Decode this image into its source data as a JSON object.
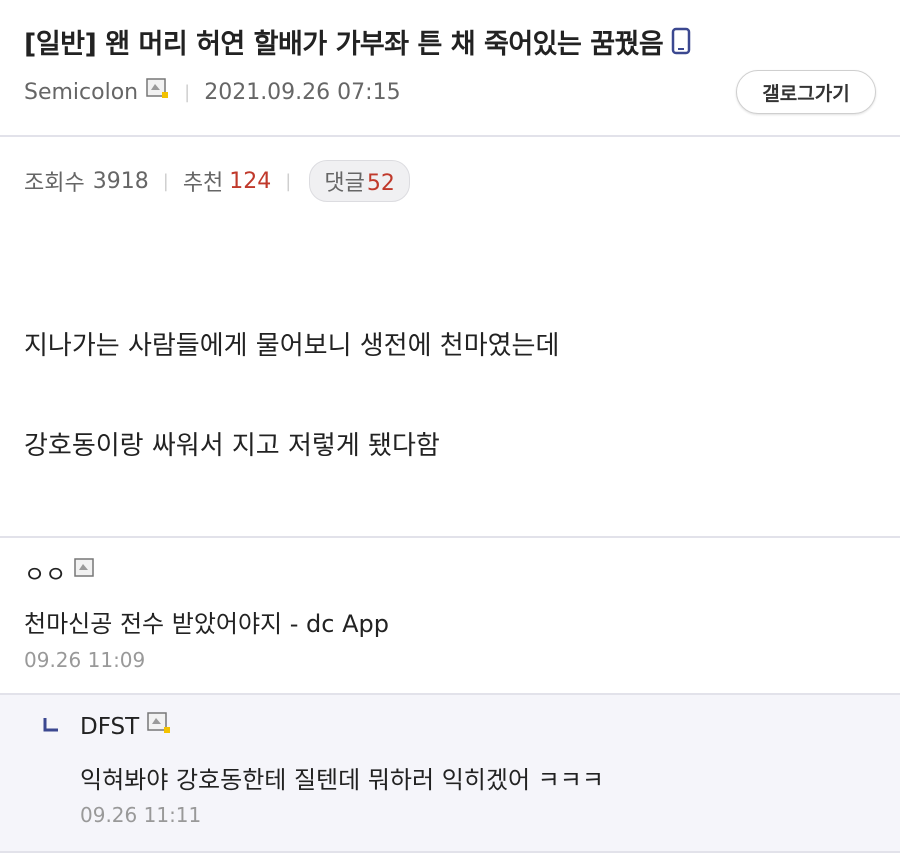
{
  "post": {
    "title": "[일반] 왠 머리 허연 할배가 가부좌 튼 채 죽어있는 꿈꿨음",
    "author": "Semicolon",
    "date": "2021.09.26 07:15",
    "gallery_button": "갤로그가기",
    "views_label": "조회수",
    "views": "3918",
    "recommend_label": "추천",
    "recommend": "124",
    "comments_label": "댓글",
    "comments": "52",
    "body_line1": "지나가는 사람들에게 물어보니 생전에 천마였는데",
    "body_line2": "강호동이랑 싸워서 지고 저렇게 됐다함"
  },
  "comments": [
    {
      "author": "ㅇㅇ",
      "text": "천마신공 전수 받았어야지 - dc App",
      "date": "09.26 11:09"
    },
    {
      "author": "DFST",
      "text": "익혀봐야 강호동한테 질텐데 뭐하러 익히겠어 ㅋㅋㅋ",
      "date": "09.26 11:11"
    }
  ],
  "colors": {
    "accent_red": "#c0392b",
    "reply_bg": "#f5f5fa",
    "reply_arrow": "#3b4890",
    "phone_icon": "#3b4890"
  }
}
